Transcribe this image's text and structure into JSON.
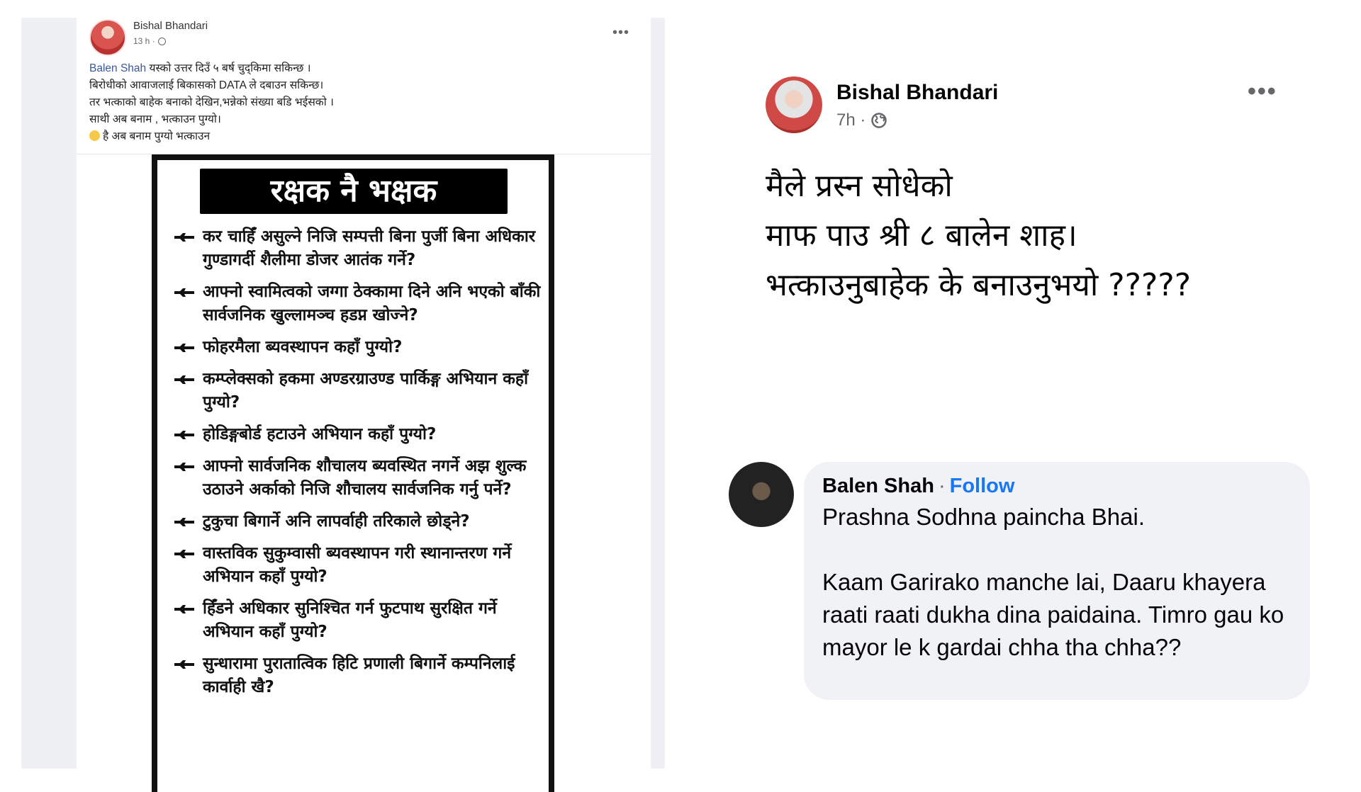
{
  "left_post": {
    "author": "Bishal Bhandari",
    "time": "13 h ·",
    "more_label": "•••",
    "mention": "Balen Shah",
    "line1_rest": " यस्को उत्तर दिउँ ५ बर्ष चुद्किमा सकिन्छ ।",
    "lines": [
      "बिरोधीको आवाजलाई बिकासको DATA ले दबाउन सकिन्छ।",
      "तर भत्काको बाहेक बनाको देखिन,भन्नेको संख्या बडि भईसको ।",
      "साथी अब बनाम , भत्काउन पुग्यो।"
    ],
    "last_line": "है अब बनाम पुग्यो भत्काउन"
  },
  "poster": {
    "title": "रक्षक नै भक्षक",
    "items": [
      "कर चाहिँ असुल्ने निजि सम्पत्ती बिना पुर्जी बिना अधिकार गुण्डागर्दी शैलीमा डोजर आतंक गर्ने?",
      "आफ्नो स्वामित्वको जग्गा ठेक्कामा दिने अनि भएको बाँकी सार्वजनिक खुल्लामञ्च हडप्न खोज्ने?",
      "फोहरमैला ब्यवस्थापन कहाँ पुग्यो?",
      "कम्प्लेक्सको हकमा अण्डरग्राउण्ड पार्किङ्ग अभियान कहाँ पुग्यो?",
      "होडिङ्गबोर्ड हटाउने अभियान कहाँ पुग्यो?",
      "आफ्नो सार्वजनिक शौचालय ब्यवस्थित नगर्ने अझ शुल्क उठाउने अर्काको निजि शौचालय सार्वजनिक गर्नु पर्ने?",
      "टुकुचा बिगार्ने अनि लापर्वाही तरिकाले छोड्ने?",
      "वास्तविक सुकुम्वासी ब्यवस्थापन गरी स्थानान्तरण गर्ने अभियान कहाँ पुग्यो?",
      "हिँडने अधिकार सुनिश्चित गर्न फुटपाथ सुरक्षित गर्ने अभियान कहाँ पुग्यो?",
      "सुन्धारामा पुरातात्विक हिटि प्रणाली बिगार्ने कम्पनिलाई कार्वाही खै?"
    ]
  },
  "right_post": {
    "author": "Bishal Bhandari",
    "time": "7h ·",
    "more_label": "•••",
    "body": [
      "मैले प्रस्न सोधेको",
      "माफ पाउ श्री ८ बालेन शाह।",
      "भत्काउनुबाहेक के बनाउनुभयो ?????"
    ]
  },
  "comment": {
    "author": "Balen Shah",
    "separator": "·",
    "follow_label": "Follow",
    "text1": "Prashna Sodhna paincha Bhai.",
    "text2": "Kaam Garirako manche lai, Daaru khayera raati raati dukha dina paidaina. Timro gau ko mayor le k gardai chha tha chha??"
  },
  "colors": {
    "link": "#385898",
    "follow": "#1877f2",
    "bubble": "#f0f2f5",
    "meta": "#65676b"
  }
}
